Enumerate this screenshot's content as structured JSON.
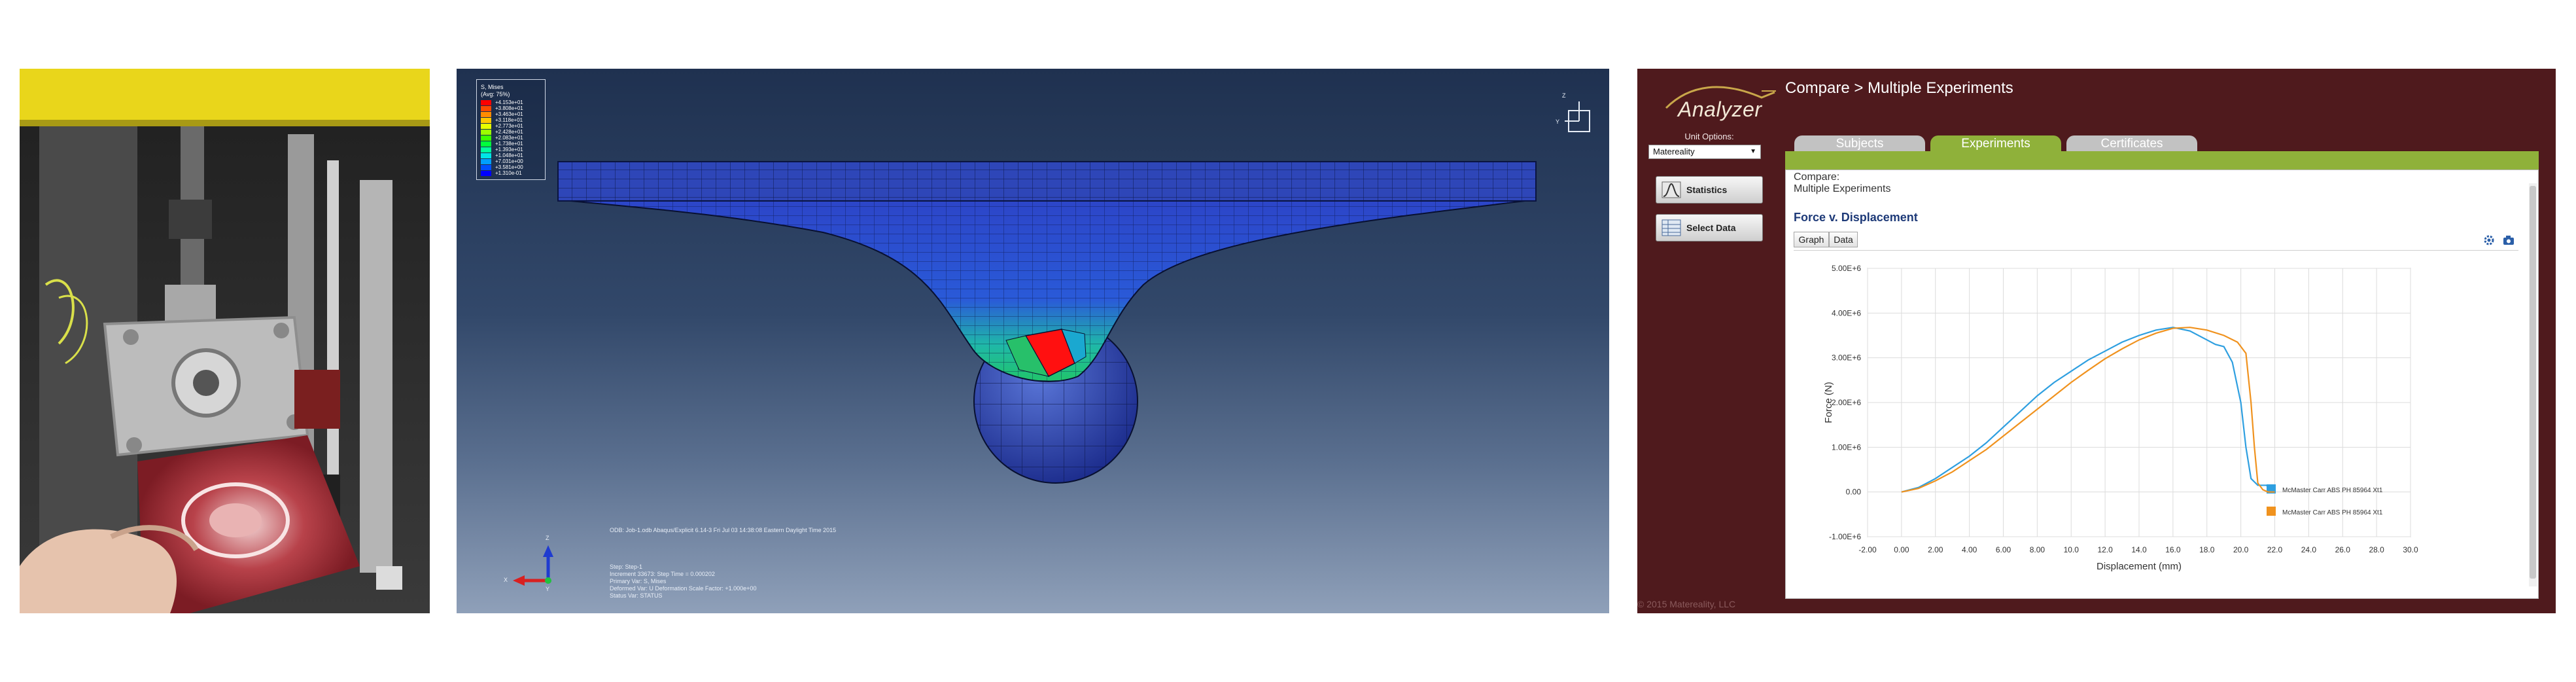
{
  "fea": {
    "legend": {
      "title_line1": "S, Mises",
      "title_line2": "(Avg: 75%)",
      "entries": [
        {
          "value": "+4.153e+01",
          "color": "#ff0000"
        },
        {
          "value": "+3.808e+01",
          "color": "#ff4a00"
        },
        {
          "value": "+3.463e+01",
          "color": "#ff8c00"
        },
        {
          "value": "+3.118e+01",
          "color": "#ffc800"
        },
        {
          "value": "+2.773e+01",
          "color": "#e6ff00"
        },
        {
          "value": "+2.428e+01",
          "color": "#9cff00"
        },
        {
          "value": "+2.083e+01",
          "color": "#3cff00"
        },
        {
          "value": "+1.738e+01",
          "color": "#00ff3c"
        },
        {
          "value": "+1.393e+01",
          "color": "#00ff9c"
        },
        {
          "value": "+1.048e+01",
          "color": "#00e6e6"
        },
        {
          "value": "+7.031e+00",
          "color": "#00a0ff"
        },
        {
          "value": "+3.581e+00",
          "color": "#0050ff"
        },
        {
          "value": "+1.310e-01",
          "color": "#0000ff"
        }
      ]
    },
    "odb_line": "ODB: Job-1.odb    Abaqus/Explicit 6.14-3    Fri Jul 03 14:38:08 Eastern Daylight Time 2015",
    "step_line": "Step: Step-1",
    "increment_line": "Increment     33673: Step Time =     0.000202 ",
    "primary_var_line": "Primary Var: S, Mises",
    "deformed_var_line": "Deformed Var: U   Deformation Scale Factor: +1.000e+00",
    "status_var_line": "Status Var: STATUS",
    "triad": {
      "x": "X",
      "y": "Y",
      "z": "Z"
    },
    "view_triad_z": "Z",
    "view_triad_y": "Y"
  },
  "app": {
    "logo": "Analyzer",
    "title": "Compare > Multiple Experiments",
    "unit_options_label": "Unit Options:",
    "unit_selected": "Matereality",
    "buttons": {
      "statistics": "Statistics",
      "select_data": "Select Data"
    },
    "tabs": [
      {
        "label": "Subjects",
        "active": false
      },
      {
        "label": "Experiments",
        "active": true
      },
      {
        "label": "Certificates",
        "active": false
      }
    ],
    "compare_label": "Compare:",
    "compare_value": "Multiple Experiments",
    "chart_heading": "Force v. Displacement",
    "view_buttons": {
      "graph": "Graph",
      "data": "Data"
    },
    "icons": {
      "settings": "gear-icon",
      "camera": "camera-icon"
    },
    "footer": "© 2015 Matereality, LLC",
    "colors": {
      "brand_bg": "#4f1a1d",
      "tab_green": "#8fb13a",
      "series_blue": "#2e9fe0",
      "series_orange": "#f0921e"
    }
  },
  "chart_data": {
    "type": "line",
    "title": "",
    "xlabel": "Displacement (mm)",
    "ylabel": "Force (N)",
    "xlim": [
      -2,
      30
    ],
    "ylim": [
      -1000000.0,
      5000000.0
    ],
    "x_ticks": [
      "-2.00",
      "0.00",
      "2.00",
      "4.00",
      "6.00",
      "8.00",
      "10.0",
      "12.0",
      "14.0",
      "16.0",
      "18.0",
      "20.0",
      "22.0",
      "24.0",
      "26.0",
      "28.0",
      "30.0"
    ],
    "y_ticks": [
      "-1.00E+6",
      "0.00",
      "1.00E+6",
      "2.00E+6",
      "3.00E+6",
      "4.00E+6",
      "5.00E+6"
    ],
    "grid": true,
    "legend_position": "bottom-right",
    "series": [
      {
        "name": "McMaster Carr ABS PH 85964 Xt1",
        "color": "#2e9fe0",
        "x": [
          0,
          1,
          2,
          3,
          4,
          5,
          6,
          7,
          8,
          9,
          10,
          11,
          12,
          13,
          14,
          15,
          16,
          17,
          18,
          18.5,
          19,
          19.5,
          20,
          20.3,
          20.6,
          21,
          21.5,
          22
        ],
        "y": [
          0,
          0.1,
          0.3,
          0.55,
          0.8,
          1.1,
          1.45,
          1.8,
          2.15,
          2.45,
          2.7,
          2.95,
          3.15,
          3.35,
          3.5,
          3.62,
          3.68,
          3.6,
          3.4,
          3.3,
          3.25,
          2.9,
          2.0,
          1.0,
          0.3,
          0.15,
          0.15,
          0.0
        ]
      },
      {
        "name": "McMaster Carr ABS PH 85964 Xt1",
        "color": "#f0921e",
        "x": [
          0,
          1,
          2,
          3,
          4,
          5,
          6,
          7,
          8,
          9,
          10,
          11,
          12,
          13,
          14,
          15,
          16,
          17,
          18,
          19,
          19.8,
          20.3,
          20.6,
          20.8,
          21,
          21.3,
          21.6,
          22
        ],
        "y": [
          0,
          0.08,
          0.25,
          0.45,
          0.7,
          0.95,
          1.25,
          1.55,
          1.85,
          2.15,
          2.45,
          2.72,
          2.98,
          3.2,
          3.4,
          3.55,
          3.66,
          3.68,
          3.62,
          3.5,
          3.35,
          3.1,
          2.0,
          1.0,
          0.2,
          0.05,
          0.0,
          0.0
        ]
      }
    ]
  }
}
